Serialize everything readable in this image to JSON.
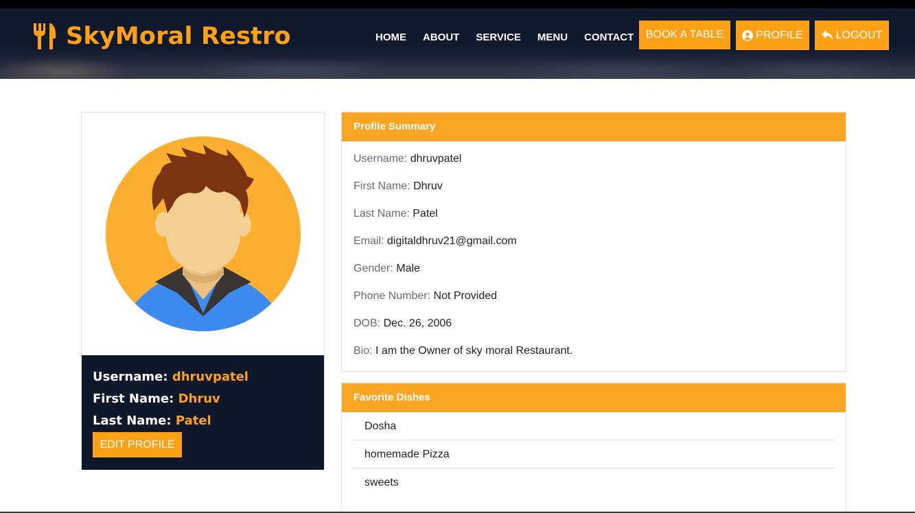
{
  "brand": {
    "name": "SkyMoral Restro",
    "icon": "fork-knife-icon",
    "color": "#fea116"
  },
  "nav": {
    "items": [
      "HOME",
      "ABOUT",
      "SERVICE",
      "MENU",
      "CONTACT"
    ]
  },
  "actions": {
    "book_label": "BOOK A TABLE",
    "profile_label": "PROFILE",
    "profile_icon": "user-circle-icon",
    "logout_label": "LOGOUT",
    "logout_icon": "reply-arrow-icon"
  },
  "profile_card": {
    "username_key": "Username:",
    "username": "dhruvpatel",
    "first_name_key": "First Name:",
    "first_name": "Dhruv",
    "last_name_key": "Last Name:",
    "last_name": "Patel",
    "edit_label": "EDIT PROFILE"
  },
  "summary": {
    "title": "Profile Summary",
    "rows": [
      {
        "key": "Username:",
        "value": "dhruvpatel"
      },
      {
        "key": "First Name:",
        "value": "Dhruv"
      },
      {
        "key": "Last Name:",
        "value": "Patel"
      },
      {
        "key": "Email:",
        "value": "digitaldhruv21@gmail.com"
      },
      {
        "key": "Gender:",
        "value": "Male"
      },
      {
        "key": "Phone Number:",
        "value": "Not Provided"
      },
      {
        "key": "DOB:",
        "value": "Dec. 26, 2006"
      },
      {
        "key": "Bio:",
        "value": "I am the Owner of sky moral Restaurant."
      }
    ]
  },
  "dishes": {
    "title": "Favorite Dishes",
    "items": [
      "Dosha",
      "homemade Pizza",
      "sweets"
    ]
  },
  "colors": {
    "accent": "#fea116",
    "navy": "#0f172b",
    "panel_header": "#fba524"
  }
}
